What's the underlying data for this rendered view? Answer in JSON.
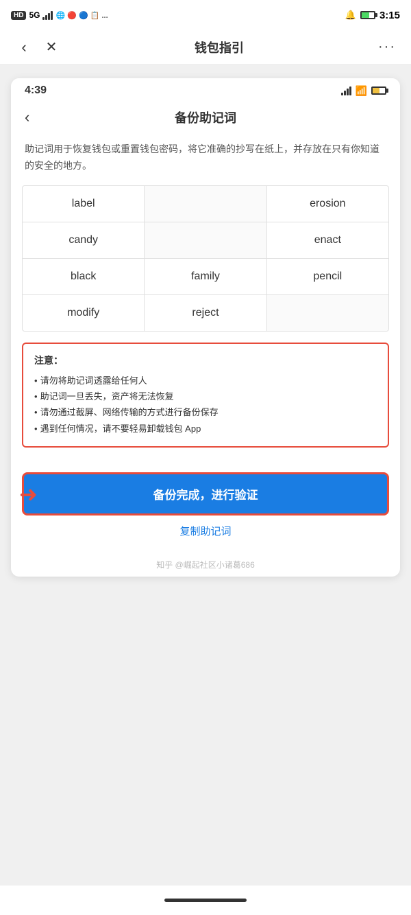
{
  "outer_status": {
    "badge": "HD",
    "signal": "5G",
    "time": "3:15"
  },
  "app_nav": {
    "title": "钱包指引",
    "back_label": "‹",
    "close_label": "✕",
    "more_label": "···"
  },
  "inner_status": {
    "time": "4:39"
  },
  "inner_nav": {
    "title": "备份助记词",
    "back_label": "‹"
  },
  "description": "助记词用于恢复钱包或重置钱包密码，将它准确的抄写在纸上，并存放在只有你知道的安全的地方。",
  "mnemonic": {
    "words": [
      [
        "label",
        "",
        "erosion"
      ],
      [
        "candy",
        "",
        "enact"
      ],
      [
        "black",
        "family",
        "pencil"
      ],
      [
        "modify",
        "reject",
        ""
      ]
    ]
  },
  "warning": {
    "title": "注意：",
    "items": [
      "请勿将助记词透露给任何人",
      "助记词一旦丢失，资产将无法恢复",
      "请勿通过截屏、网络传输的方式进行备份保存",
      "遇到任何情况，请不要轻易卸载钱包 App"
    ]
  },
  "actions": {
    "verify_button": "备份完成，进行验证",
    "copy_link": "复制助记词"
  },
  "watermark": "知乎 @崛起社区小诸葛686"
}
